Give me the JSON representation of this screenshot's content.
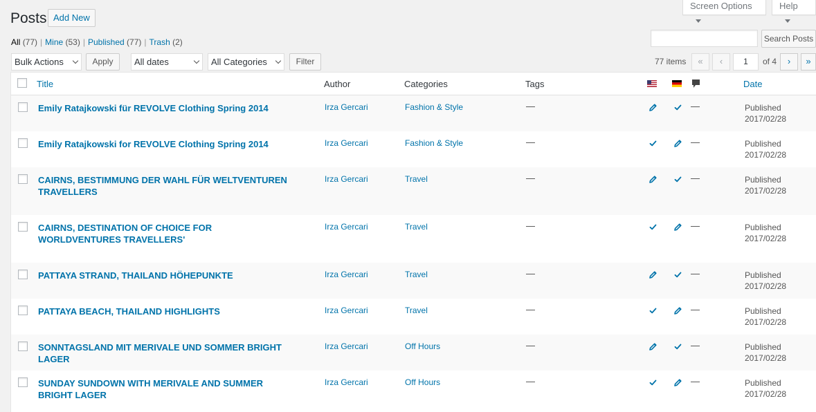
{
  "top": {
    "screen_options": "Screen Options",
    "help": "Help"
  },
  "header": {
    "title": "Posts",
    "add_new": "Add New"
  },
  "views": {
    "all_label": "All",
    "all_count": "(77)",
    "mine_label": "Mine",
    "mine_count": "(53)",
    "published_label": "Published",
    "published_count": "(77)",
    "trash_label": "Trash",
    "trash_count": "(2)",
    "sep": "|"
  },
  "search": {
    "button": "Search Posts",
    "placeholder": ""
  },
  "toolbar": {
    "bulk_actions": "Bulk Actions",
    "apply": "Apply",
    "dates": "All dates",
    "categories": "All Categories",
    "filter": "Filter",
    "items": "77 items",
    "first": "«",
    "prev": "‹",
    "current_page": "1",
    "of_pages": "of 4",
    "next": "›",
    "last": "»"
  },
  "columns": {
    "title": "Title",
    "author": "Author",
    "categories": "Categories",
    "tags": "Tags",
    "date": "Date"
  },
  "colors": {
    "link": "#0073aa",
    "flag_us": "#b22234",
    "flag_de_red": "#dd0000",
    "flag_de_gold": "#ffce00"
  },
  "rows": [
    {
      "title": "Emily Ratajkowski für REVOLVE Clothing Spring 2014",
      "author": "Irza Gercari",
      "category": "Fashion & Style",
      "tags": "—",
      "lang_en": "edit",
      "lang_de": "check",
      "comments": "—",
      "status": "Published",
      "date": "2017/02/28"
    },
    {
      "title": "Emily Ratajkowski for REVOLVE Clothing Spring 2014",
      "author": "Irza Gercari",
      "category": "Fashion & Style",
      "tags": "—",
      "lang_en": "check",
      "lang_de": "edit",
      "comments": "—",
      "status": "Published",
      "date": "2017/02/28"
    },
    {
      "title": "CAIRNS, BESTIMMUNG DER WAHL FÜR WELTVENTUREN TRAVELLERS",
      "author": "Irza Gercari",
      "category": "Travel",
      "tags": "—",
      "lang_en": "edit",
      "lang_de": "check",
      "comments": "—",
      "status": "Published",
      "date": "2017/02/28"
    },
    {
      "title": "CAIRNS, DESTINATION OF CHOICE FOR WORLDVENTURES TRAVELLERS'",
      "author": "Irza Gercari",
      "category": "Travel",
      "tags": "—",
      "lang_en": "check",
      "lang_de": "edit",
      "comments": "—",
      "status": "Published",
      "date": "2017/02/28"
    },
    {
      "title": "PATTAYA STRAND, THAILAND HÖHEPUNKTE",
      "author": "Irza Gercari",
      "category": "Travel",
      "tags": "—",
      "lang_en": "edit",
      "lang_de": "check",
      "comments": "—",
      "status": "Published",
      "date": "2017/02/28"
    },
    {
      "title": "PATTAYA BEACH, THAILAND HIGHLIGHTS",
      "author": "Irza Gercari",
      "category": "Travel",
      "tags": "—",
      "lang_en": "check",
      "lang_de": "edit",
      "comments": "—",
      "status": "Published",
      "date": "2017/02/28"
    },
    {
      "title": "SONNTAGSLAND MIT MERIVALE UND SOMMER BRIGHT LAGER",
      "author": "Irza Gercari",
      "category": "Off Hours",
      "tags": "—",
      "lang_en": "edit",
      "lang_de": "check",
      "comments": "—",
      "status": "Published",
      "date": "2017/02/28"
    },
    {
      "title": "SUNDAY SUNDOWN WITH MERIVALE AND SUMMER BRIGHT LAGER",
      "author": "Irza Gercari",
      "category": "Off Hours",
      "tags": "—",
      "lang_en": "check",
      "lang_de": "edit",
      "comments": "—",
      "status": "Published",
      "date": "2017/02/28"
    }
  ]
}
